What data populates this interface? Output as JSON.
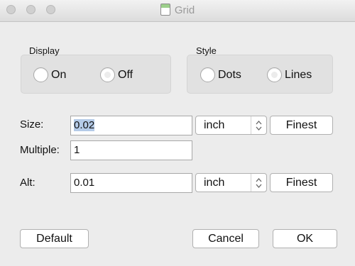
{
  "window": {
    "title": "Grid",
    "title_icon": "document-icon"
  },
  "display_group": {
    "label": "Display",
    "options": [
      "On",
      "Off"
    ]
  },
  "style_group": {
    "label": "Style",
    "options": [
      "Dots",
      "Lines"
    ]
  },
  "size": {
    "label": "Size:",
    "value": "0.02",
    "unit": "inch",
    "preset_button": "Finest"
  },
  "multiple": {
    "label": "Multiple:",
    "value": "1"
  },
  "alt": {
    "label": "Alt:",
    "value": "0.01",
    "unit": "inch",
    "preset_button": "Finest"
  },
  "buttons": {
    "default": "Default",
    "cancel": "Cancel",
    "ok": "OK"
  }
}
